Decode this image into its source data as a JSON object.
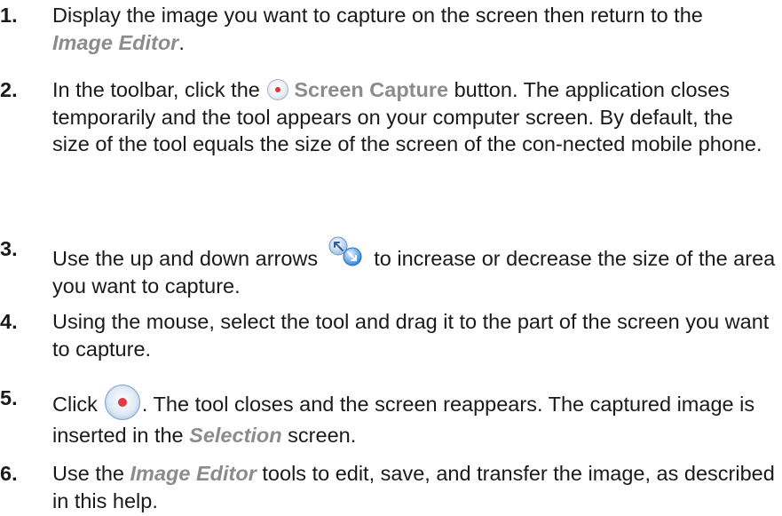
{
  "steps": [
    {
      "number": "1.",
      "parts": {
        "a": "Display the image you want to capture on the screen then return to the",
        "b": "Image Editor",
        "c": "."
      }
    },
    {
      "number": "2.",
      "parts": {
        "a": "In the toolbar, click the",
        "b": "Screen Capture",
        "c": "button. The application closes temporarily and the tool appears on your computer screen. By default, the size of the tool equals the size of the screen of the con-nected mobile phone."
      },
      "icon": "record-icon"
    },
    {
      "number": "3.",
      "parts": {
        "a": "Use the up and down arrows",
        "b": "to increase or decrease the size of the area you want to capture."
      },
      "icon": "resize-arrows-icon"
    },
    {
      "number": "4.",
      "parts": {
        "a": "Using the mouse, select the tool and drag it to the part of the screen you want to capture."
      }
    },
    {
      "number": "5.",
      "parts": {
        "a": "Click",
        "b": ". The tool closes and the screen reappears. The captured image is inserted in the",
        "c": "Selection",
        "d": "screen."
      },
      "icon": "capture-button-icon"
    },
    {
      "number": "6.",
      "parts": {
        "a": "Use the",
        "b": "Image Editor",
        "c": "tools to edit, save, and transfer the image, as described in this help."
      }
    }
  ],
  "colors": {
    "text": "#1a1a1a",
    "ui_term": "#8c8c8c",
    "record_red": "#e8332c",
    "icon_blue": "#4a86c8"
  }
}
